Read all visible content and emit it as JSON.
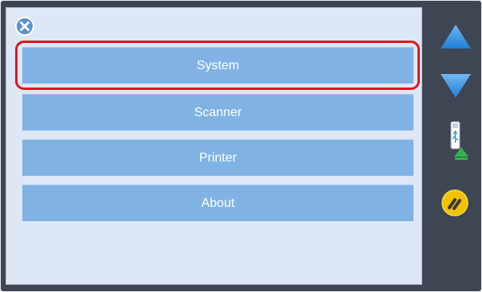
{
  "menu": {
    "items": [
      {
        "label": "System",
        "selected": true
      },
      {
        "label": "Scanner",
        "selected": false
      },
      {
        "label": "Printer",
        "selected": false
      },
      {
        "label": "About",
        "selected": false
      }
    ]
  },
  "icons": {
    "close": "close-icon",
    "scroll_up": "up-arrow-icon",
    "scroll_down": "down-arrow-icon",
    "usb_upload": "usb-upload-icon",
    "tools": "tools-icon"
  },
  "colors": {
    "frame": "#3e4553",
    "panel": "#dde7f5",
    "menu_item": "#80b3e4",
    "selection_ring": "#e0161c",
    "arrow": "#2f8fe0",
    "tools_badge": "#f2c200"
  }
}
